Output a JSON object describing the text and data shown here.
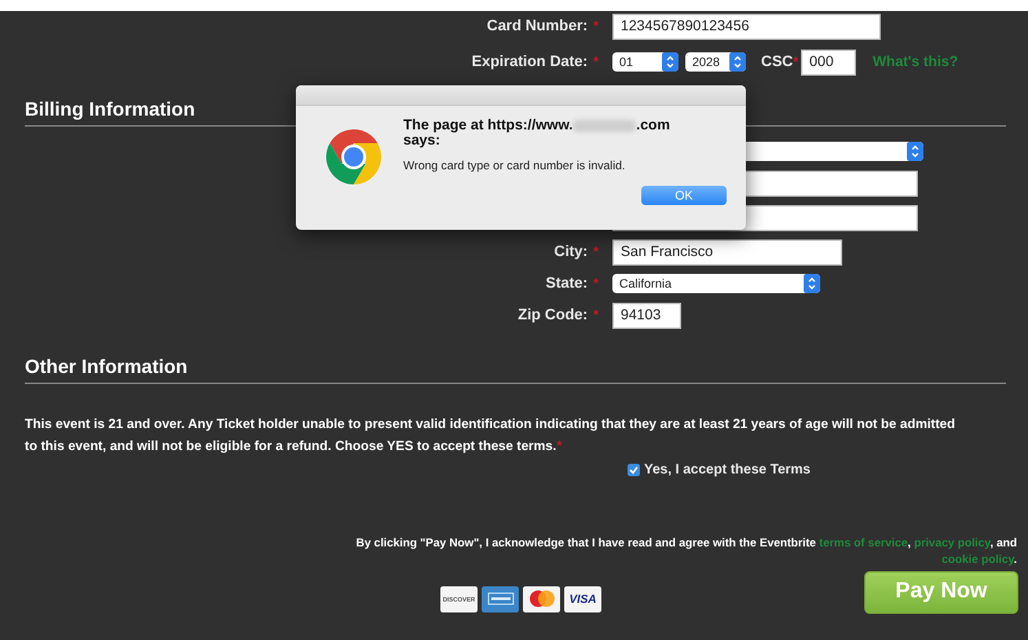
{
  "payment": {
    "card_number": {
      "label": "Card Number:",
      "required_mark": "*",
      "value": "1234567890123456"
    },
    "expiration": {
      "label": "Expiration Date:",
      "required_mark": "*",
      "month": "01",
      "year": "2028"
    },
    "csc": {
      "label": "CSC",
      "required_mark": "*",
      "value": "000",
      "help_link": "What's this?"
    }
  },
  "billing": {
    "heading": "Billing Information",
    "fields": [
      {
        "kind": "select"
      },
      {
        "kind": "input"
      },
      {
        "kind": "input"
      },
      {
        "kind": "input",
        "label": "City:",
        "required_mark": "*",
        "value": "San Francisco"
      },
      {
        "kind": "select",
        "label": "State:",
        "required_mark": "*",
        "value": "California"
      },
      {
        "kind": "input",
        "label": "Zip Code:",
        "required_mark": "*",
        "value": "94103"
      }
    ]
  },
  "other": {
    "heading": "Other Information",
    "terms_text": "This event is 21 and over. Any Ticket holder unable to present valid identification indicating that they are at least 21 years of age will not be admitted to this event, and will not be eligible for a refund. Choose YES to accept these terms.",
    "required_mark": "*",
    "accept": {
      "label": "Yes, I accept these Terms",
      "checked": true
    }
  },
  "footer": {
    "disclaimer": "By clicking \"Pay Now\", I acknowledge that I have read and agree with the Eventbrite",
    "links": [
      "terms of service",
      "privacy policy",
      "cookie policy"
    ],
    "separators": [
      ",",
      ", and",
      "."
    ],
    "cards": [
      {
        "kind": "discover",
        "text": "DISCOVER"
      },
      {
        "kind": "amex"
      },
      {
        "kind": "mastercard"
      },
      {
        "kind": "visa",
        "text": "VISA"
      }
    ],
    "pay_button": "Pay Now"
  },
  "dialog": {
    "title_start": "The page at https://www.",
    "title_end": ".com",
    "title_line2": "says:",
    "message": "Wrong card type or card number is invalid.",
    "button": "OK"
  }
}
